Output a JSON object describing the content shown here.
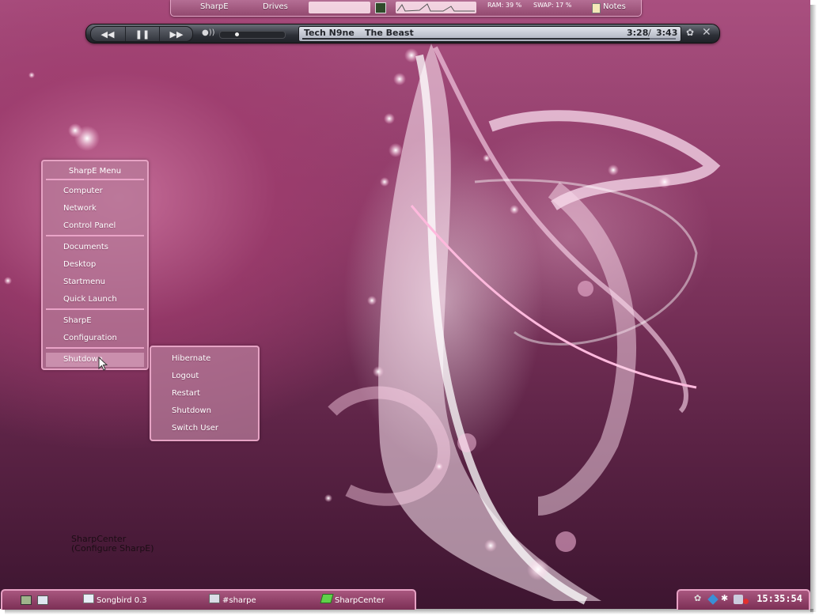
{
  "top_bar": {
    "sharpe_label": "SharpE",
    "drives_label": "Drives",
    "ram_label": "RAM: 39 %",
    "swap_label": "SWAP: 17 %",
    "notes_label": "Notes"
  },
  "media_player": {
    "artist": "Tech N9ne",
    "track": "The Beast",
    "elapsed": "3:28",
    "separator": "/",
    "duration": "3:43",
    "progress_fraction": 0.93,
    "volume_fraction": 0.25
  },
  "start_menu": {
    "title": "SharpE Menu",
    "groups": [
      [
        "Computer",
        "Network",
        "Control Panel"
      ],
      [
        "Documents",
        "Desktop",
        "Startmenu",
        "Quick Launch"
      ],
      [
        "SharpE",
        "Configuration"
      ],
      [
        "Shutdown"
      ]
    ],
    "hovered_item": "Shutdown"
  },
  "shutdown_submenu": {
    "items": [
      "Hibernate",
      "Logout",
      "Restart",
      "Shutdown",
      "Switch User"
    ]
  },
  "tooltip": {
    "line1": "SharpCenter",
    "line2": "(Configure SharpE)"
  },
  "taskbar": {
    "tasks": [
      "Songbird 0.3",
      "#sharpe",
      "SharpCenter"
    ]
  },
  "tray": {
    "clock": "15:35:54"
  },
  "colors": {
    "menu_border": "#e6a3c4",
    "bar_border": "#e7a1c4",
    "media_bar": "#2c2f36"
  }
}
